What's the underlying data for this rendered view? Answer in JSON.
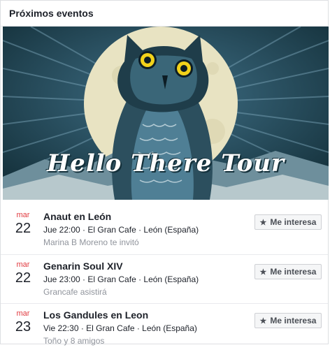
{
  "header": {
    "title": "Próximos eventos"
  },
  "banner": {
    "script_text": "Hello There Tour"
  },
  "events": [
    {
      "month": "mar",
      "day": "22",
      "title": "Anaut en León",
      "meta": "Jue 22:00 · El Gran Cafe · León (España)",
      "social": "Marina B Moreno te invitó",
      "button": "Me interesa"
    },
    {
      "month": "mar",
      "day": "22",
      "title": "Genarin Soul XIV",
      "meta": "Jue 23:00 · El Gran Cafe · León (España)",
      "social": "Grancafe asistirá",
      "button": "Me interesa"
    },
    {
      "month": "mar",
      "day": "23",
      "title": "Los Gandules en Leon",
      "meta": "Vie 22:30 · El Gran Cafe · León (España)",
      "social": "Toño y 8 amigos",
      "button": "Me interesa"
    }
  ],
  "colors": {
    "month_red": "#e0393e",
    "banner_dark": "#14303a",
    "banner_blue": "#5a8aa3",
    "moon": "#e8e3c2",
    "owl_eye": "#f2d21a"
  },
  "icons": {
    "button_icon": "star-icon"
  }
}
